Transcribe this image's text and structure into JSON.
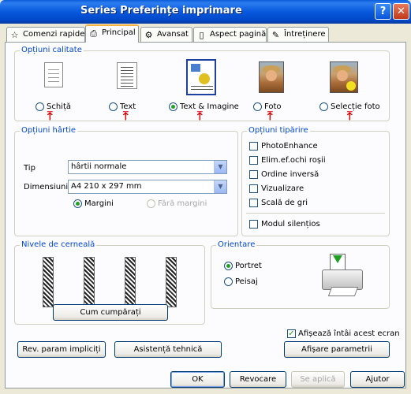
{
  "window": {
    "title": "Series Preferințe imprimare",
    "help_label": "?",
    "close_label": "✕"
  },
  "tabs": [
    {
      "label": "Comenzi rapide",
      "icon": "star-icon"
    },
    {
      "label": "Principal",
      "icon": "printer-icon"
    },
    {
      "label": "Avansat",
      "icon": "gear-icon"
    },
    {
      "label": "Aspect pagină",
      "icon": "page-icon"
    },
    {
      "label": "Întreținere",
      "icon": "wrench-icon"
    }
  ],
  "quality": {
    "legend": "Opțiuni calitate",
    "options": [
      "Schiță",
      "Text",
      "Text & Imagine",
      "Foto",
      "Selecție foto"
    ],
    "selected": "Text & Imagine"
  },
  "paper": {
    "legend": "Opțiuni hârtie",
    "type_label": "Tip",
    "type_value": "hârtii normale",
    "size_label": "Dimensiuni",
    "size_value": "A4 210 x 297 mm",
    "margins_label": "Margini",
    "no_margins_label": "Fără margini"
  },
  "print_options": {
    "legend": "Opțiuni tipărire",
    "items": [
      "PhotoEnhance",
      "Elim.ef.ochi roșii",
      "Ordine inversă",
      "Vizualizare",
      "Scală de gri"
    ],
    "silent_label": "Modul silențios"
  },
  "ink": {
    "legend": "Nivele de cerneală",
    "buy_label": "Cum cumpărați"
  },
  "orientation": {
    "legend": "Orientare",
    "portrait": "Portret",
    "landscape": "Peisaj",
    "selected": "Portret"
  },
  "footer": {
    "show_first_label": "Afișează întâi acest ecran",
    "show_first_checked": true,
    "reset_label": "Rev. param impliciți",
    "support_label": "Asistență tehnică",
    "show_settings_label": "Afișare parametrii"
  },
  "dialog": {
    "ok": "OK",
    "cancel": "Revocare",
    "apply": "Se aplică",
    "help": "Ajutor"
  }
}
